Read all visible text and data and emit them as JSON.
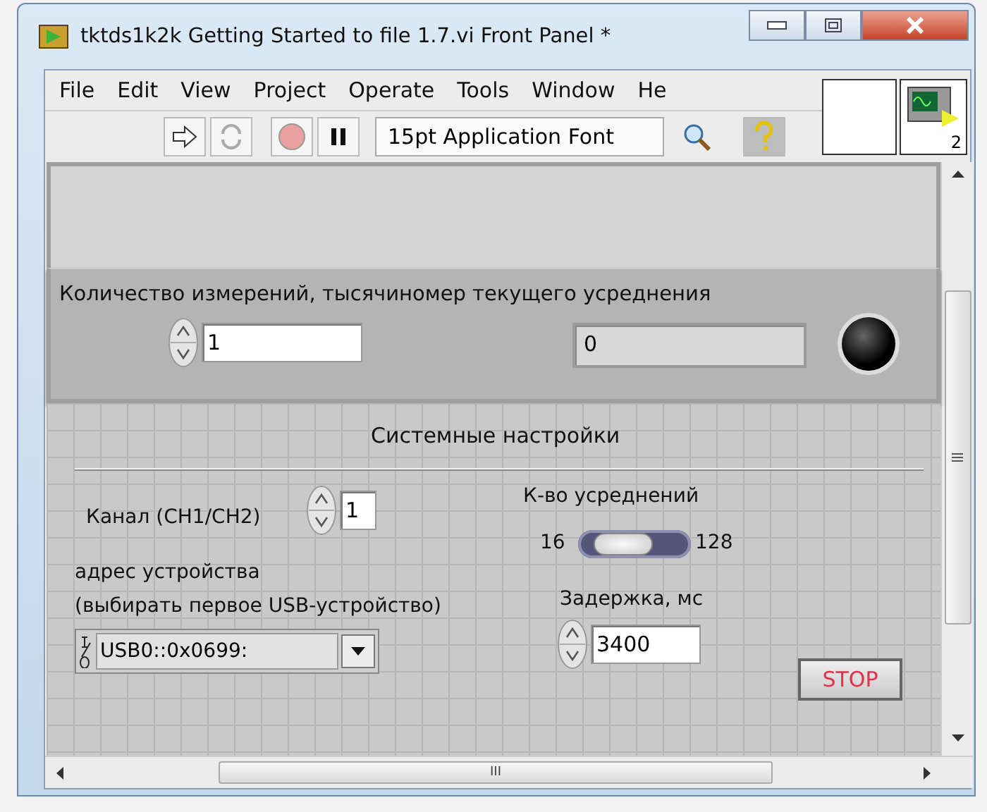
{
  "window": {
    "title": "tktds1k2k Getting Started to file 1.7.vi Front Panel *"
  },
  "menu": [
    "File",
    "Edit",
    "View",
    "Project",
    "Operate",
    "Tools",
    "Window",
    "He"
  ],
  "toolbar": {
    "font_selector": "15pt Application Font"
  },
  "connector_pane": {
    "count": "2"
  },
  "top_cluster": {
    "label": "Количество измерений, тысячиномер текущего усреднения",
    "count_value": "1",
    "current_value": "0",
    "led_on": false
  },
  "settings": {
    "title": "Системные настройки",
    "channel": {
      "label": "Канал (CH1/CH2)",
      "value": "1"
    },
    "averages": {
      "label": "К-во усреднений",
      "min": "16",
      "max": "128",
      "level": 0.3
    },
    "address": {
      "label_lines": [
        "адрес устройства",
        "(выбирать первое USB-устройство)"
      ],
      "value": "USB0::0x0699:"
    },
    "delay": {
      "label": "Задержка, мс",
      "value": "3400"
    },
    "stop_button": "STOP"
  },
  "scrollbar_horizontal": {
    "grip": "III"
  }
}
